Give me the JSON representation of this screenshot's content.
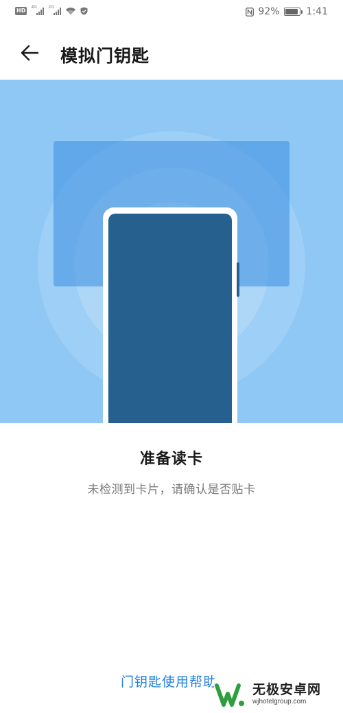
{
  "status_bar": {
    "hd_label": "HD",
    "network_1": "4G",
    "network_2": "2G",
    "battery_percent": "92%",
    "battery_level": 0.92,
    "time": "1:41",
    "icons": [
      "hd-icon",
      "signal-icon",
      "signal-icon",
      "wifi-icon",
      "shield-icon",
      "nfc-icon",
      "battery-icon"
    ]
  },
  "header": {
    "back_icon": "arrow-left-icon",
    "title": "模拟门钥匙"
  },
  "illustration": {
    "colors": {
      "background": "#90c8f5",
      "ripple": "#ffffff",
      "card": "#5aa5e6",
      "phone_body": "#25608f",
      "phone_frame": "#ffffff"
    }
  },
  "status": {
    "title": "准备读卡",
    "description": "未检测到卡片，请确认是否贴卡"
  },
  "footer": {
    "help_link": "门钥匙使用帮助",
    "link_color": "#1f7fe0"
  },
  "watermark": {
    "name": "无极安卓网",
    "url": "wjhotelgroup.com"
  }
}
